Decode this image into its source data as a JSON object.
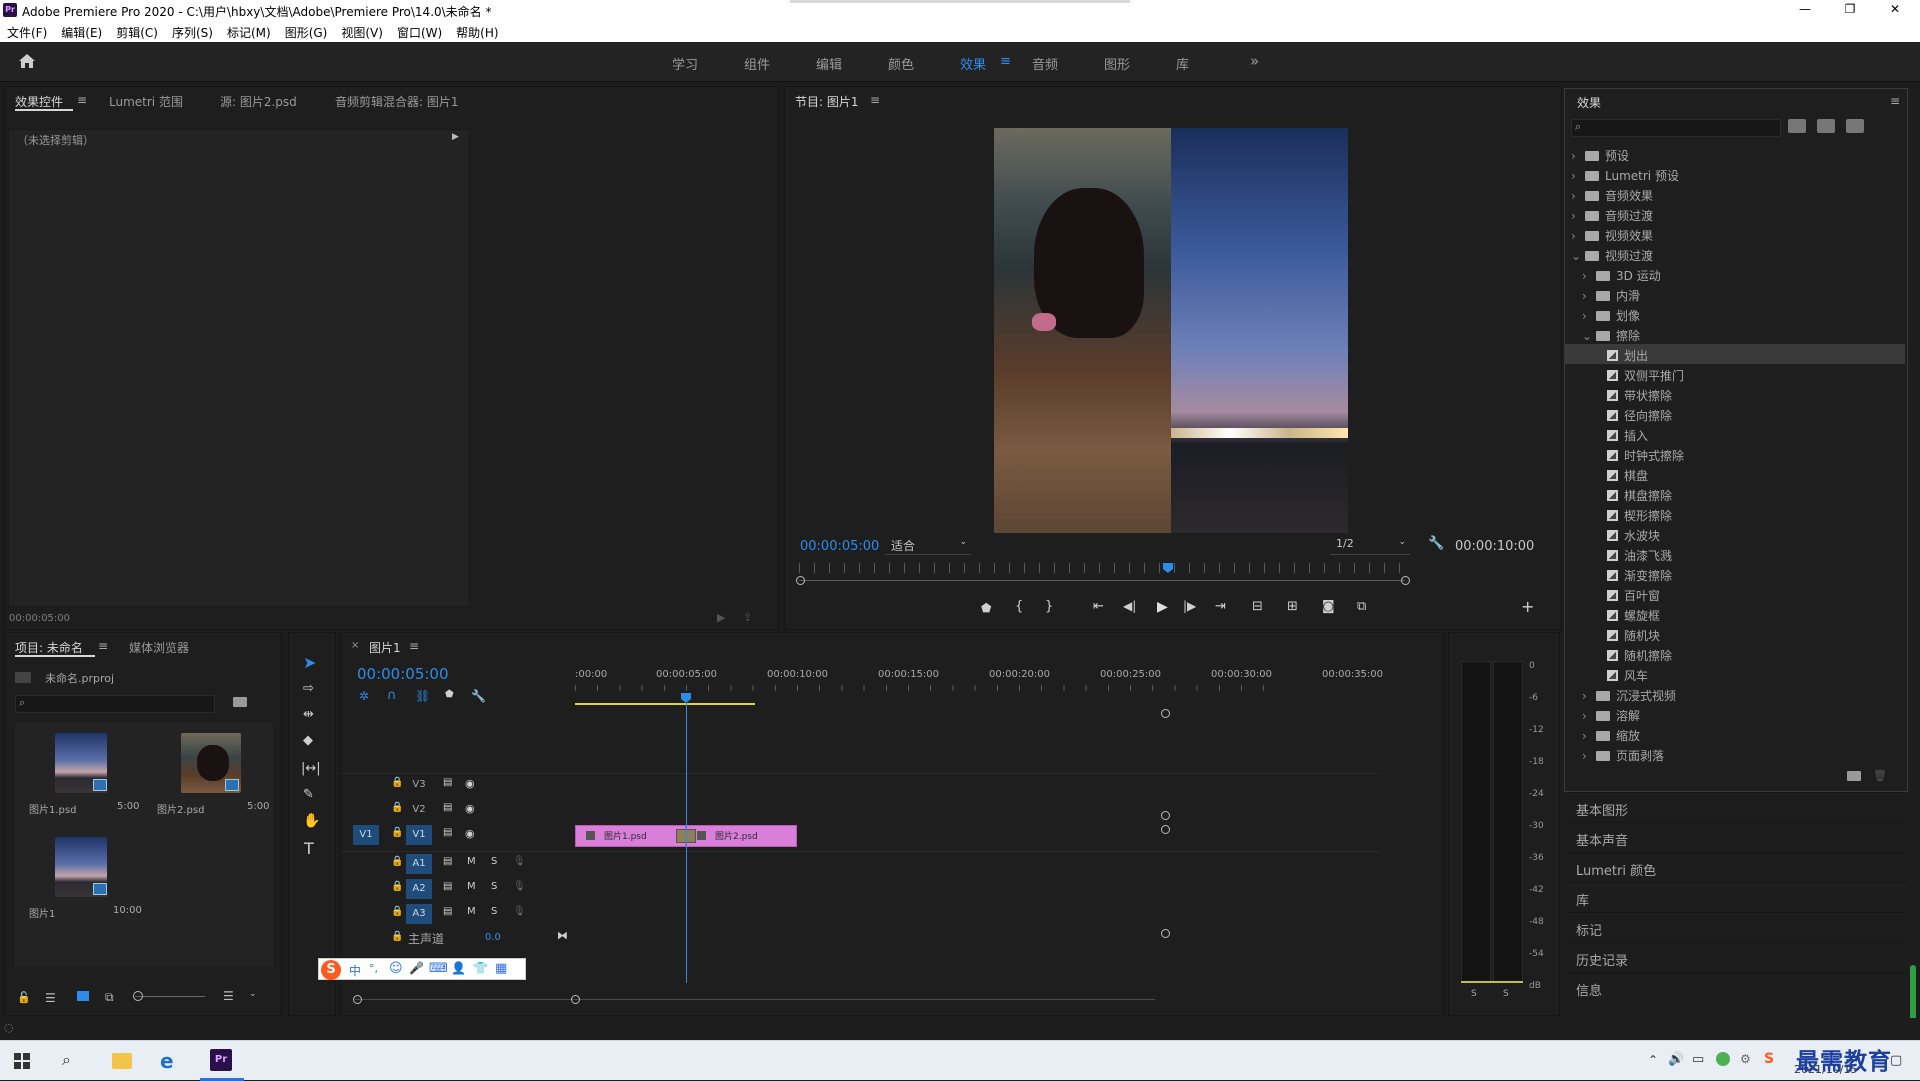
{
  "window": {
    "title": "Adobe Premiere Pro 2020 - C:\\用户\\hbxy\\文档\\Adobe\\Premiere Pro\\14.0\\未命名 *",
    "app_icon": "Pr",
    "controls": [
      "—",
      "❐",
      "✕"
    ]
  },
  "menu": [
    "文件(F)",
    "编辑(E)",
    "剪辑(C)",
    "序列(S)",
    "标记(M)",
    "图形(G)",
    "视图(V)",
    "窗口(W)",
    "帮助(H)"
  ],
  "workspaces": {
    "items": [
      "学习",
      "组件",
      "编辑",
      "颜色",
      "效果",
      "音频",
      "图形",
      "库"
    ],
    "active": "效果",
    "more": "»"
  },
  "source_panel": {
    "tabs": [
      "效果控件",
      "Lumetri 范围",
      "源: 图片2.psd",
      "音频剪辑混合器: 图片1"
    ],
    "placeholder": "（未选择剪辑）",
    "timecode": "00:00:05:00"
  },
  "program_monitor": {
    "title": "节目: 图片1",
    "timecode": "00:00:05:00",
    "fit": "适合",
    "resolution": "1/2",
    "duration": "00:00:10:00",
    "playhead_fraction": 0.5
  },
  "effects_panel": {
    "title": "效果",
    "tree": [
      {
        "label": "预设",
        "level": 0,
        "type": "folder",
        "open": false
      },
      {
        "label": "Lumetri 预设",
        "level": 0,
        "type": "folder",
        "open": false
      },
      {
        "label": "音频效果",
        "level": 0,
        "type": "folder",
        "open": false
      },
      {
        "label": "音频过渡",
        "level": 0,
        "type": "folder",
        "open": false
      },
      {
        "label": "视频效果",
        "level": 0,
        "type": "folder",
        "open": false
      },
      {
        "label": "视频过渡",
        "level": 0,
        "type": "folder",
        "open": true
      },
      {
        "label": "3D 运动",
        "level": 1,
        "type": "folder",
        "open": false
      },
      {
        "label": "内滑",
        "level": 1,
        "type": "folder",
        "open": false
      },
      {
        "label": "划像",
        "level": 1,
        "type": "folder",
        "open": false
      },
      {
        "label": "擦除",
        "level": 1,
        "type": "folder",
        "open": true
      },
      {
        "label": "划出",
        "level": 2,
        "type": "effect",
        "selected": true
      },
      {
        "label": "双侧平推门",
        "level": 2,
        "type": "effect"
      },
      {
        "label": "带状擦除",
        "level": 2,
        "type": "effect"
      },
      {
        "label": "径向擦除",
        "level": 2,
        "type": "effect"
      },
      {
        "label": "插入",
        "level": 2,
        "type": "effect"
      },
      {
        "label": "时钟式擦除",
        "level": 2,
        "type": "effect"
      },
      {
        "label": "棋盘",
        "level": 2,
        "type": "effect"
      },
      {
        "label": "棋盘擦除",
        "level": 2,
        "type": "effect"
      },
      {
        "label": "楔形擦除",
        "level": 2,
        "type": "effect"
      },
      {
        "label": "水波块",
        "level": 2,
        "type": "effect"
      },
      {
        "label": "油漆飞溅",
        "level": 2,
        "type": "effect"
      },
      {
        "label": "渐变擦除",
        "level": 2,
        "type": "effect"
      },
      {
        "label": "百叶窗",
        "level": 2,
        "type": "effect"
      },
      {
        "label": "螺旋框",
        "level": 2,
        "type": "effect"
      },
      {
        "label": "随机块",
        "level": 2,
        "type": "effect"
      },
      {
        "label": "随机擦除",
        "level": 2,
        "type": "effect"
      },
      {
        "label": "风车",
        "level": 2,
        "type": "effect"
      },
      {
        "label": "沉浸式视频",
        "level": 1,
        "type": "folder",
        "open": false
      },
      {
        "label": "溶解",
        "level": 1,
        "type": "folder",
        "open": false
      },
      {
        "label": "缩放",
        "level": 1,
        "type": "folder",
        "open": false
      },
      {
        "label": "页面剥落",
        "level": 1,
        "type": "folder",
        "open": false
      }
    ]
  },
  "side_panels": [
    "基本图形",
    "基本声音",
    "Lumetri 颜色",
    "库",
    "标记",
    "历史记录",
    "信息"
  ],
  "project_panel": {
    "tabs": [
      "项目: 未命名",
      "媒体浏览器"
    ],
    "file": "未命名.prproj",
    "items": [
      {
        "name": "图片1.psd",
        "duration": "5:00"
      },
      {
        "name": "图片2.psd",
        "duration": "5:00"
      },
      {
        "name": "图片1",
        "duration": "10:00"
      }
    ]
  },
  "timeline": {
    "title": "图片1",
    "timecode": "00:00:05:00",
    "ruler": [
      ":00:00",
      "00:00:05:00",
      "00:00:10:00",
      "00:00:15:00",
      "00:00:20:00",
      "00:00:25:00",
      "00:00:30:00",
      "00:00:35:00"
    ],
    "video_tracks": [
      "V3",
      "V2",
      "V1"
    ],
    "audio_tracks": [
      "A1",
      "A2",
      "A3"
    ],
    "source_patch": "V1",
    "master": {
      "label": "主声道",
      "value": "0.0"
    },
    "clips": [
      {
        "name": "图片1.psd",
        "start": 0,
        "end": 5
      },
      {
        "name": "图片2.psd",
        "start": 5,
        "end": 10
      }
    ],
    "playhead_seconds": 5,
    "track_buttons": {
      "mute": "M",
      "solo": "S"
    }
  },
  "audio_meter": {
    "scale": [
      "0",
      "-6",
      "-12",
      "-18",
      "-24",
      "-30",
      "-36",
      "-42",
      "-48",
      "-54",
      "dB"
    ],
    "buttons": [
      "S",
      "S"
    ]
  },
  "ime_toolbar": {
    "items": [
      "S",
      "中",
      "°,",
      "☺",
      "🎤",
      "⌨",
      "👤",
      "👕",
      "▦"
    ]
  },
  "taskbar": {
    "date": "2021/10/15",
    "watermark": "最需教育"
  },
  "colors": {
    "accent": "#2d8ceb",
    "clip": "#d97fd9",
    "transition_icon": "#8c7f5a",
    "playhead": "#2d8ceb"
  }
}
